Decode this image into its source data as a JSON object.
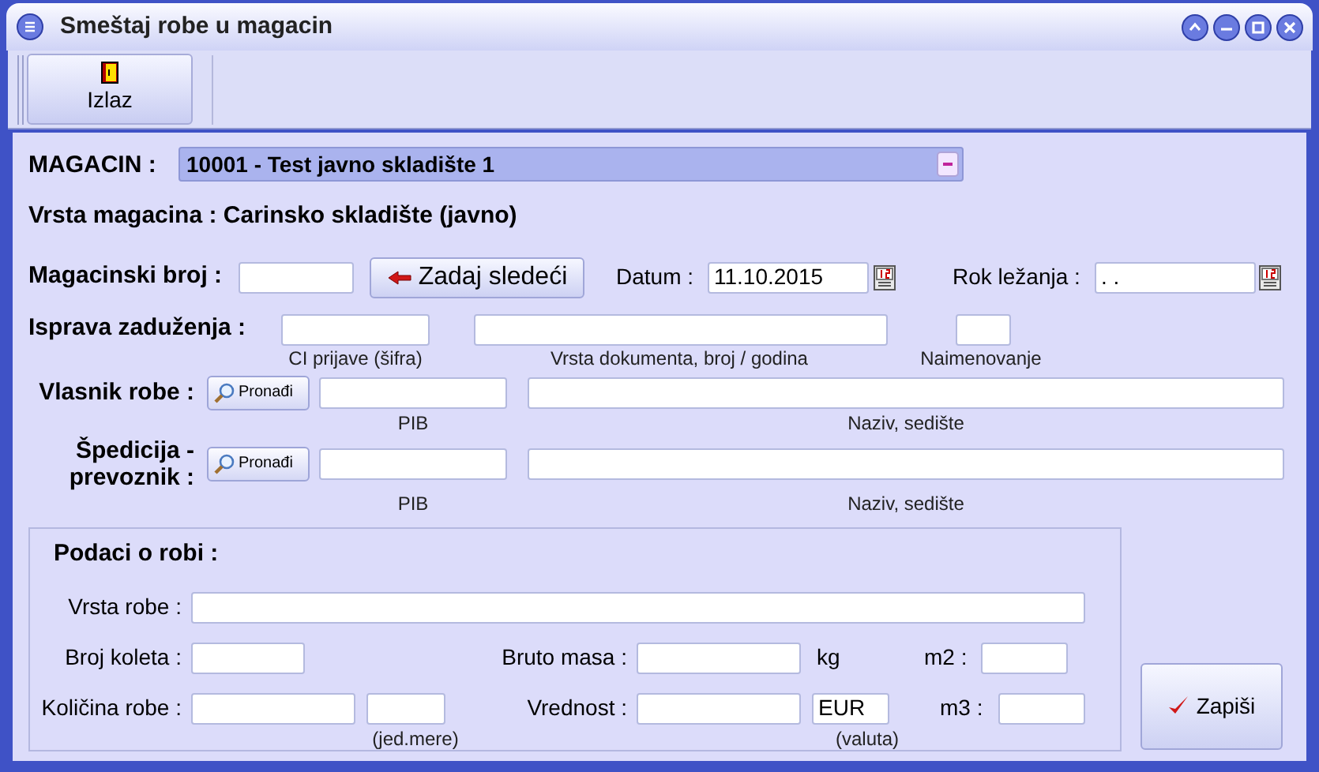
{
  "window": {
    "title": "Smeštaj robe u magacin"
  },
  "toolbar": {
    "exit_button": "Izlaz"
  },
  "warehouse": {
    "label": "MAGACIN :",
    "value": "10001 - Test javno skladište 1"
  },
  "warehouse_type": "Vrsta magacina : Carinsko skladište (javno)",
  "warehouse_number": {
    "label": "Magacinski broj :",
    "next_button": "Zadaj sledeći"
  },
  "date": {
    "label": "Datum :",
    "value": "11.10.2015"
  },
  "storage_deadline": {
    "label": "Rok ležanja :",
    "value": ". ."
  },
  "charge_document": {
    "label": "Isprava zaduženja :",
    "captions": [
      "CI prijave (šifra)",
      "Vrsta dokumenta, broj / godina",
      "Naimenovanje"
    ]
  },
  "goods_owner": {
    "label": "Vlasnik robe :",
    "find_button": "Pronađi",
    "captions": [
      "PIB",
      "Naziv, sedište"
    ]
  },
  "forwarder": {
    "label": "Špedicija - prevoznik :",
    "find_button": "Pronađi",
    "captions": [
      "PIB",
      "Naziv, sedište"
    ]
  },
  "goods": {
    "title": "Podaci o robi :",
    "type_label": "Vrsta robe :",
    "packages_label": "Broj koleta :",
    "gross_label": "Bruto masa :",
    "gross_unit": "kg",
    "m2_label": "m2 :",
    "quantity_label": "Količina robe :",
    "unit_caption": "(jed.mere)",
    "value_label": "Vrednost :",
    "currency": "EUR",
    "currency_caption": "(valuta)",
    "m3_label": "m3 :"
  },
  "save_button": "Zapiši"
}
